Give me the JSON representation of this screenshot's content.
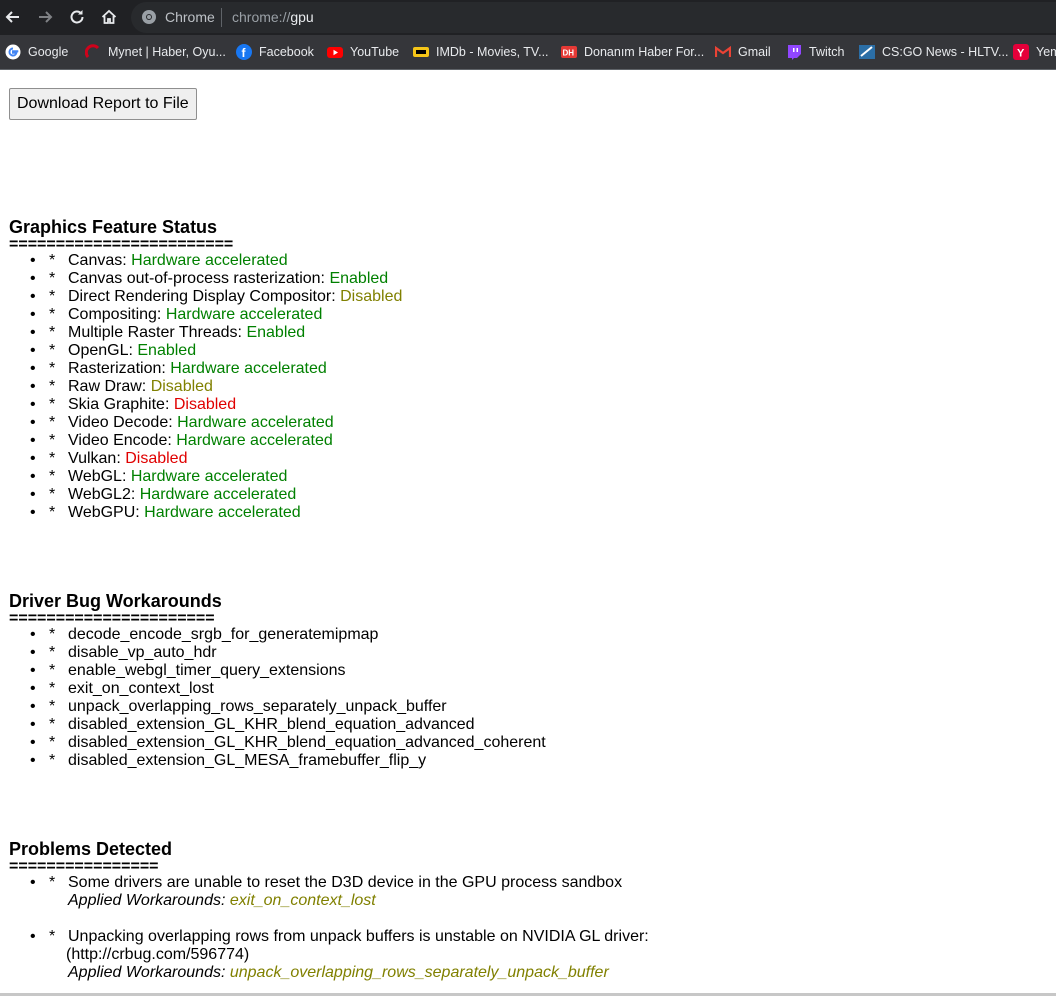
{
  "toolbar": {
    "omnibox_chip": "Chrome",
    "url_scheme": "chrome://",
    "url_host": "gpu"
  },
  "bookmarks": [
    {
      "label": "Google",
      "icon": "google-icon"
    },
    {
      "label": "Mynet | Haber, Oyu...",
      "icon": "mynet-icon"
    },
    {
      "label": "Facebook",
      "icon": "facebook-icon"
    },
    {
      "label": "YouTube",
      "icon": "youtube-icon"
    },
    {
      "label": "IMDb - Movies, TV...",
      "icon": "imdb-icon"
    },
    {
      "label": "Donanım Haber For...",
      "icon": "donanimhaber-icon"
    },
    {
      "label": "Gmail",
      "icon": "gmail-icon"
    },
    {
      "label": "Twitch",
      "icon": "twitch-icon"
    },
    {
      "label": "CS:GO News - HLTV...",
      "icon": "hltv-icon"
    },
    {
      "label": "Yem",
      "icon": "yemek-icon"
    }
  ],
  "download_button": "Download Report to File",
  "feature_status": {
    "title": "Graphics Feature Status",
    "rule": "========================",
    "items": [
      {
        "name": "Canvas: ",
        "status": "Hardware accelerated",
        "color": "g"
      },
      {
        "name": "Canvas out-of-process rasterization: ",
        "status": "Enabled",
        "color": "g"
      },
      {
        "name": "Direct Rendering Display Compositor: ",
        "status": "Disabled",
        "color": "y"
      },
      {
        "name": "Compositing: ",
        "status": "Hardware accelerated",
        "color": "g"
      },
      {
        "name": "Multiple Raster Threads: ",
        "status": "Enabled",
        "color": "g"
      },
      {
        "name": "OpenGL: ",
        "status": "Enabled",
        "color": "g"
      },
      {
        "name": "Rasterization: ",
        "status": "Hardware accelerated",
        "color": "g"
      },
      {
        "name": "Raw Draw: ",
        "status": "Disabled",
        "color": "y"
      },
      {
        "name": "Skia Graphite: ",
        "status": "Disabled",
        "color": "r"
      },
      {
        "name": "Video Decode: ",
        "status": "Hardware accelerated",
        "color": "g"
      },
      {
        "name": "Video Encode: ",
        "status": "Hardware accelerated",
        "color": "g"
      },
      {
        "name": "Vulkan: ",
        "status": "Disabled",
        "color": "r"
      },
      {
        "name": "WebGL: ",
        "status": "Hardware accelerated",
        "color": "g"
      },
      {
        "name": "WebGL2: ",
        "status": "Hardware accelerated",
        "color": "g"
      },
      {
        "name": "WebGPU: ",
        "status": "Hardware accelerated",
        "color": "g"
      }
    ]
  },
  "workarounds": {
    "title": "Driver Bug Workarounds",
    "rule": "======================",
    "items": [
      "decode_encode_srgb_for_generatemipmap",
      "disable_vp_auto_hdr",
      "enable_webgl_timer_query_extensions",
      "exit_on_context_lost",
      "unpack_overlapping_rows_separately_unpack_buffer",
      "disabled_extension_GL_KHR_blend_equation_advanced",
      "disabled_extension_GL_KHR_blend_equation_advanced_coherent",
      "disabled_extension_GL_MESA_framebuffer_flip_y"
    ]
  },
  "problems": {
    "title": "Problems Detected",
    "rule": "================",
    "items": [
      {
        "text": "Some drivers are unable to reset the D3D device in the GPU process sandbox",
        "extra": "",
        "workaround_label": "Applied Workarounds: ",
        "workaround": "exit_on_context_lost"
      },
      {
        "text": "Unpacking overlapping rows from unpack buffers is unstable on NVIDIA GL driver:",
        "extra": "(http://crbug.com/596774)",
        "workaround_label": "Applied Workarounds: ",
        "workaround": "unpack_overlapping_rows_separately_unpack_buffer"
      }
    ]
  },
  "colors": {
    "enabled": "#008000",
    "disabled_soft": "#808000",
    "disabled": "#e00000"
  }
}
